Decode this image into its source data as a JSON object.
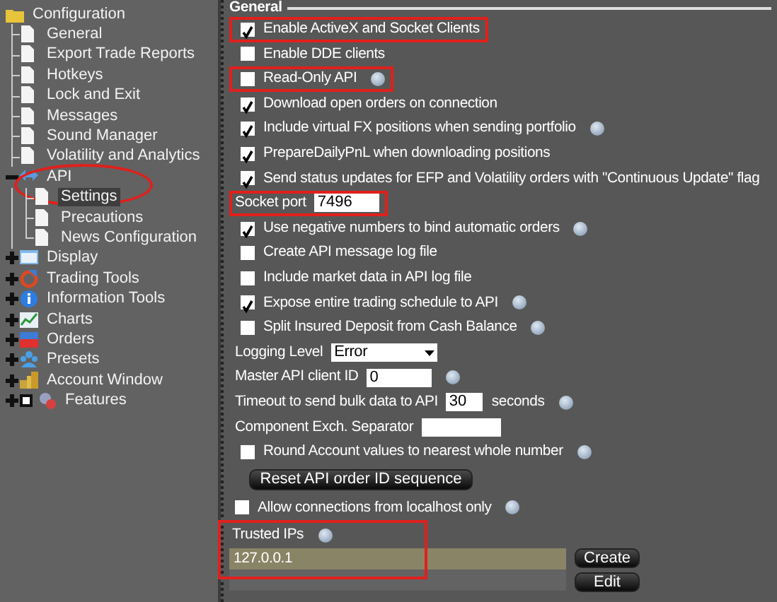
{
  "tree": [
    {
      "label": "Configuration",
      "kind": "folder",
      "selected": false,
      "expanded": true,
      "children": [
        {
          "label": "General",
          "kind": "page",
          "selected": false
        },
        {
          "label": "Export Trade Reports",
          "kind": "page",
          "selected": false
        },
        {
          "label": "Hotkeys",
          "kind": "page",
          "selected": false
        },
        {
          "label": "Lock and Exit",
          "kind": "page",
          "selected": false
        },
        {
          "label": "Messages",
          "kind": "page",
          "selected": false
        },
        {
          "label": "Sound Manager",
          "kind": "page",
          "selected": false
        },
        {
          "label": "Volatility and Analytics",
          "kind": "page",
          "selected": false
        },
        {
          "label": "API",
          "kind": "api",
          "selected": false,
          "expanded": true,
          "circled": true,
          "children": [
            {
              "label": "Settings",
              "kind": "page",
              "selected": true
            },
            {
              "label": "Precautions",
              "kind": "page",
              "selected": false
            },
            {
              "label": "News Configuration",
              "kind": "page",
              "selected": false
            }
          ]
        },
        {
          "label": "Display",
          "kind": "display",
          "selected": false,
          "expanded": false
        },
        {
          "label": "Trading Tools",
          "kind": "tools",
          "selected": false,
          "expanded": false
        },
        {
          "label": "Information Tools",
          "kind": "info",
          "selected": false,
          "expanded": false
        },
        {
          "label": "Charts",
          "kind": "charts",
          "selected": false,
          "expanded": false
        },
        {
          "label": "Orders",
          "kind": "orders",
          "selected": false,
          "expanded": false
        },
        {
          "label": "Presets",
          "kind": "presets",
          "selected": false,
          "expanded": false
        },
        {
          "label": "Account Window",
          "kind": "account",
          "selected": false,
          "expanded": false
        },
        {
          "label": "Features",
          "kind": "features",
          "selected": false,
          "expanded": false
        }
      ]
    }
  ],
  "section": {
    "title": "General"
  },
  "settings": [
    {
      "kind": "checkbox",
      "label": "Enable ActiveX and Socket Clients",
      "checked": true,
      "info": false,
      "highlighted": true
    },
    {
      "kind": "checkbox",
      "label": "Enable DDE clients",
      "checked": false,
      "info": false,
      "highlighted": false
    },
    {
      "kind": "checkbox",
      "label": "Read-Only API",
      "checked": false,
      "info": true,
      "highlighted": true
    },
    {
      "kind": "checkbox",
      "label": "Download open orders on connection",
      "checked": true,
      "info": false,
      "highlighted": false
    },
    {
      "kind": "checkbox",
      "label": "Include virtual FX positions when sending portfolio",
      "checked": true,
      "info": true,
      "highlighted": false
    },
    {
      "kind": "checkbox",
      "label": "PrepareDailyPnL when downloading positions",
      "checked": true,
      "info": false,
      "highlighted": false
    },
    {
      "kind": "checkbox",
      "label": "Send status updates for EFP and Volatility orders with \"Continuous Update\" flag",
      "checked": true,
      "info": false,
      "highlighted": false
    },
    {
      "kind": "field",
      "label": "Socket port",
      "value": "7496",
      "info": false,
      "highlighted": true
    },
    {
      "kind": "checkbox",
      "label": "Use negative numbers to bind automatic orders",
      "checked": true,
      "info": true,
      "highlighted": false
    },
    {
      "kind": "checkbox",
      "label": "Create API message log file",
      "checked": false,
      "info": false,
      "highlighted": false
    },
    {
      "kind": "checkbox",
      "label": "Include market data in API log file",
      "checked": false,
      "info": false,
      "highlighted": false
    },
    {
      "kind": "checkbox",
      "label": "Expose entire trading schedule to API",
      "checked": true,
      "info": true,
      "highlighted": false
    },
    {
      "kind": "checkbox",
      "label": "Split Insured Deposit from Cash Balance",
      "checked": false,
      "info": true,
      "highlighted": false
    },
    {
      "kind": "select",
      "label": "Logging Level",
      "value": "Error",
      "info": false,
      "highlighted": false
    },
    {
      "kind": "field",
      "label": "Master API client ID",
      "value": "0",
      "info": true,
      "highlighted": false
    },
    {
      "kind": "field",
      "label": "Timeout to send bulk data to API",
      "value": "30",
      "suffix": "seconds",
      "info": true,
      "highlighted": false
    },
    {
      "kind": "field",
      "label": "Component Exch. Separator",
      "info": false,
      "highlighted": false
    },
    {
      "kind": "checkbox",
      "label": "Round Account values to nearest whole number",
      "checked": false,
      "info": true,
      "highlighted": false
    },
    {
      "kind": "button",
      "label": "Reset API order ID sequence"
    },
    {
      "kind": "checkbox",
      "label": "Allow connections from localhost only",
      "checked": false,
      "info": true,
      "highlighted": false
    }
  ],
  "trusted_ips": {
    "label": "Trusted IPs",
    "info": true,
    "highlighted": true,
    "rows": [
      {
        "text": "127.0.0.1",
        "selected": true
      }
    ],
    "buttons": [
      "Create",
      "Edit"
    ]
  }
}
